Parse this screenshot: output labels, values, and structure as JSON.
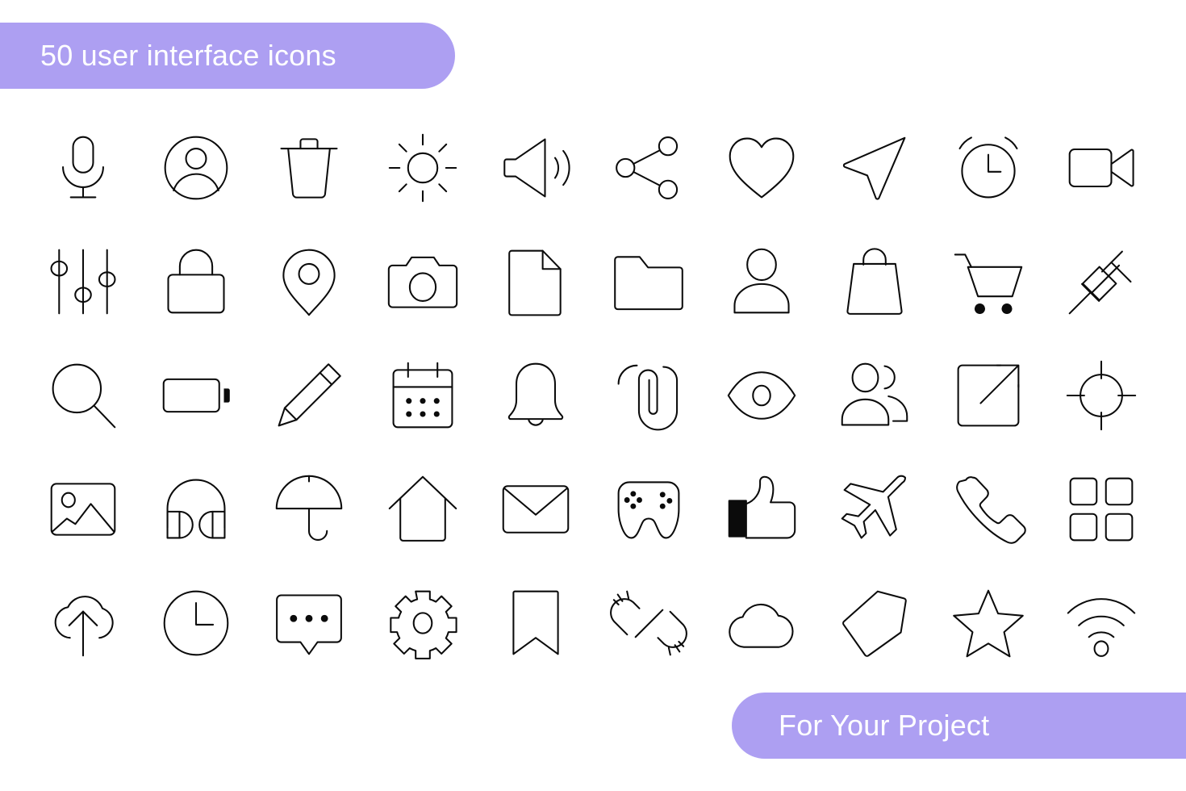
{
  "banners": {
    "top": {
      "label": "50 user interface icons",
      "color": "#ad9ff2",
      "text_color": "#ffffff"
    },
    "bottom": {
      "label": "For Your Project",
      "color": "#ad9ff2",
      "text_color": "#ffffff"
    }
  },
  "grid": {
    "columns": 10,
    "rows": 5,
    "total_icons": 50,
    "stroke_color": "#0b0b0b",
    "background": "#ffffff"
  },
  "icons": [
    {
      "index": 1,
      "name": "microphone-icon",
      "row": 1,
      "col": 1
    },
    {
      "index": 2,
      "name": "user-circle-icon",
      "row": 1,
      "col": 2
    },
    {
      "index": 3,
      "name": "trash-icon",
      "row": 1,
      "col": 3
    },
    {
      "index": 4,
      "name": "sun-brightness-icon",
      "row": 1,
      "col": 4
    },
    {
      "index": 5,
      "name": "volume-icon",
      "row": 1,
      "col": 5
    },
    {
      "index": 6,
      "name": "share-icon",
      "row": 1,
      "col": 6
    },
    {
      "index": 7,
      "name": "heart-icon",
      "row": 1,
      "col": 7
    },
    {
      "index": 8,
      "name": "send-icon",
      "row": 1,
      "col": 8
    },
    {
      "index": 9,
      "name": "alarm-clock-icon",
      "row": 1,
      "col": 9
    },
    {
      "index": 10,
      "name": "video-camera-icon",
      "row": 1,
      "col": 10
    },
    {
      "index": 11,
      "name": "sliders-icon",
      "row": 2,
      "col": 1
    },
    {
      "index": 12,
      "name": "lock-icon",
      "row": 2,
      "col": 2
    },
    {
      "index": 13,
      "name": "map-pin-icon",
      "row": 2,
      "col": 3
    },
    {
      "index": 14,
      "name": "camera-icon",
      "row": 2,
      "col": 4
    },
    {
      "index": 15,
      "name": "file-icon",
      "row": 2,
      "col": 5
    },
    {
      "index": 16,
      "name": "folder-icon",
      "row": 2,
      "col": 6
    },
    {
      "index": 17,
      "name": "user-icon",
      "row": 2,
      "col": 7
    },
    {
      "index": 18,
      "name": "shopping-bag-icon",
      "row": 2,
      "col": 8
    },
    {
      "index": 19,
      "name": "shopping-cart-icon",
      "row": 2,
      "col": 9
    },
    {
      "index": 20,
      "name": "pushpin-icon",
      "row": 2,
      "col": 10
    },
    {
      "index": 21,
      "name": "search-icon",
      "row": 3,
      "col": 1
    },
    {
      "index": 22,
      "name": "battery-icon",
      "row": 3,
      "col": 2
    },
    {
      "index": 23,
      "name": "pencil-icon",
      "row": 3,
      "col": 3
    },
    {
      "index": 24,
      "name": "calendar-icon",
      "row": 3,
      "col": 4
    },
    {
      "index": 25,
      "name": "bell-icon",
      "row": 3,
      "col": 5
    },
    {
      "index": 26,
      "name": "paperclip-icon",
      "row": 3,
      "col": 6
    },
    {
      "index": 27,
      "name": "eye-icon",
      "row": 3,
      "col": 7
    },
    {
      "index": 28,
      "name": "users-group-icon",
      "row": 3,
      "col": 8
    },
    {
      "index": 29,
      "name": "external-link-icon",
      "row": 3,
      "col": 9
    },
    {
      "index": 30,
      "name": "target-icon",
      "row": 3,
      "col": 10
    },
    {
      "index": 31,
      "name": "image-icon",
      "row": 4,
      "col": 1
    },
    {
      "index": 32,
      "name": "headphones-icon",
      "row": 4,
      "col": 2
    },
    {
      "index": 33,
      "name": "umbrella-icon",
      "row": 4,
      "col": 3
    },
    {
      "index": 34,
      "name": "home-icon",
      "row": 4,
      "col": 4
    },
    {
      "index": 35,
      "name": "mail-icon",
      "row": 4,
      "col": 5
    },
    {
      "index": 36,
      "name": "gamepad-icon",
      "row": 4,
      "col": 6
    },
    {
      "index": 37,
      "name": "thumbs-up-icon",
      "row": 4,
      "col": 7
    },
    {
      "index": 38,
      "name": "airplane-icon",
      "row": 4,
      "col": 8
    },
    {
      "index": 39,
      "name": "phone-icon",
      "row": 4,
      "col": 9
    },
    {
      "index": 40,
      "name": "grid-apps-icon",
      "row": 4,
      "col": 10
    },
    {
      "index": 41,
      "name": "cloud-upload-icon",
      "row": 5,
      "col": 1
    },
    {
      "index": 42,
      "name": "clock-icon",
      "row": 5,
      "col": 2
    },
    {
      "index": 43,
      "name": "chat-bubble-icon",
      "row": 5,
      "col": 3
    },
    {
      "index": 44,
      "name": "gear-icon",
      "row": 5,
      "col": 4
    },
    {
      "index": 45,
      "name": "bookmark-icon",
      "row": 5,
      "col": 5
    },
    {
      "index": 46,
      "name": "broken-link-icon",
      "row": 5,
      "col": 6
    },
    {
      "index": 47,
      "name": "cloud-icon",
      "row": 5,
      "col": 7
    },
    {
      "index": 48,
      "name": "tag-icon",
      "row": 5,
      "col": 8
    },
    {
      "index": 49,
      "name": "star-icon",
      "row": 5,
      "col": 9
    },
    {
      "index": 50,
      "name": "wifi-icon",
      "row": 5,
      "col": 10
    }
  ]
}
